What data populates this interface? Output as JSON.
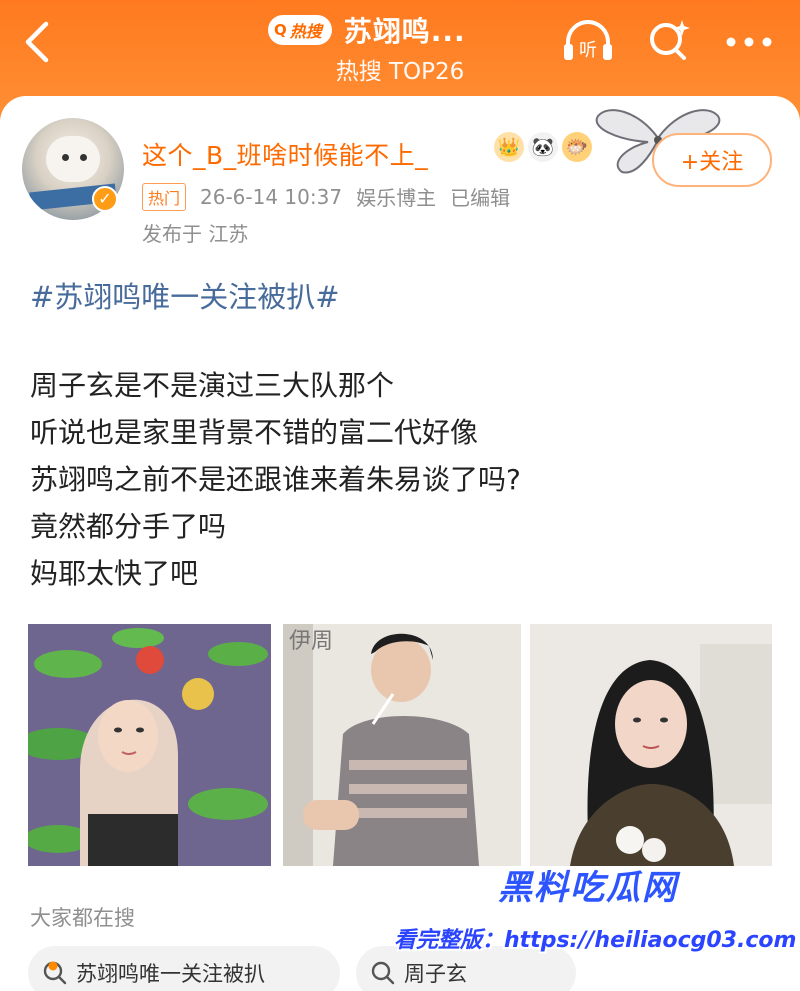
{
  "header": {
    "hot_label": "热搜",
    "title": "苏翊鸣...",
    "subtitle": "热搜 TOP26",
    "listen_label": "听"
  },
  "post": {
    "username": "这个_B_班啥时候能不上_",
    "hot_tag": "热门",
    "datetime": "26-6-14 10:37",
    "role": "娱乐博主",
    "edited": "已编辑",
    "location": "发布于 江苏",
    "follow_label": "+关注",
    "hashtag": "#苏翊鸣唯一关注被扒#",
    "lines": [
      "周子玄是不是演过三大队那个",
      "听说也是家里背景不错的富二代好像",
      "苏翊鸣之前不是还跟谁来着朱易谈了吗?",
      "竟然都分手了吗",
      "妈耶太快了吧"
    ],
    "photos": [
      {
        "name": "photo-girl-hood"
      },
      {
        "name": "photo-man-striped-shirt",
        "caption": "伊周"
      },
      {
        "name": "photo-woman-portrait"
      }
    ]
  },
  "related": {
    "title": "大家都在搜",
    "chips": [
      {
        "text": "苏翊鸣唯一关注被扒"
      },
      {
        "text": "周子玄"
      }
    ]
  },
  "watermark": {
    "title": "黑料吃瓜网",
    "url": "看完整版：https://heiliaocg03.com"
  },
  "colors": {
    "header_orange": "#ff7a1f",
    "username_orange": "#ff6a00",
    "hashtag_blue": "#476b9b"
  }
}
